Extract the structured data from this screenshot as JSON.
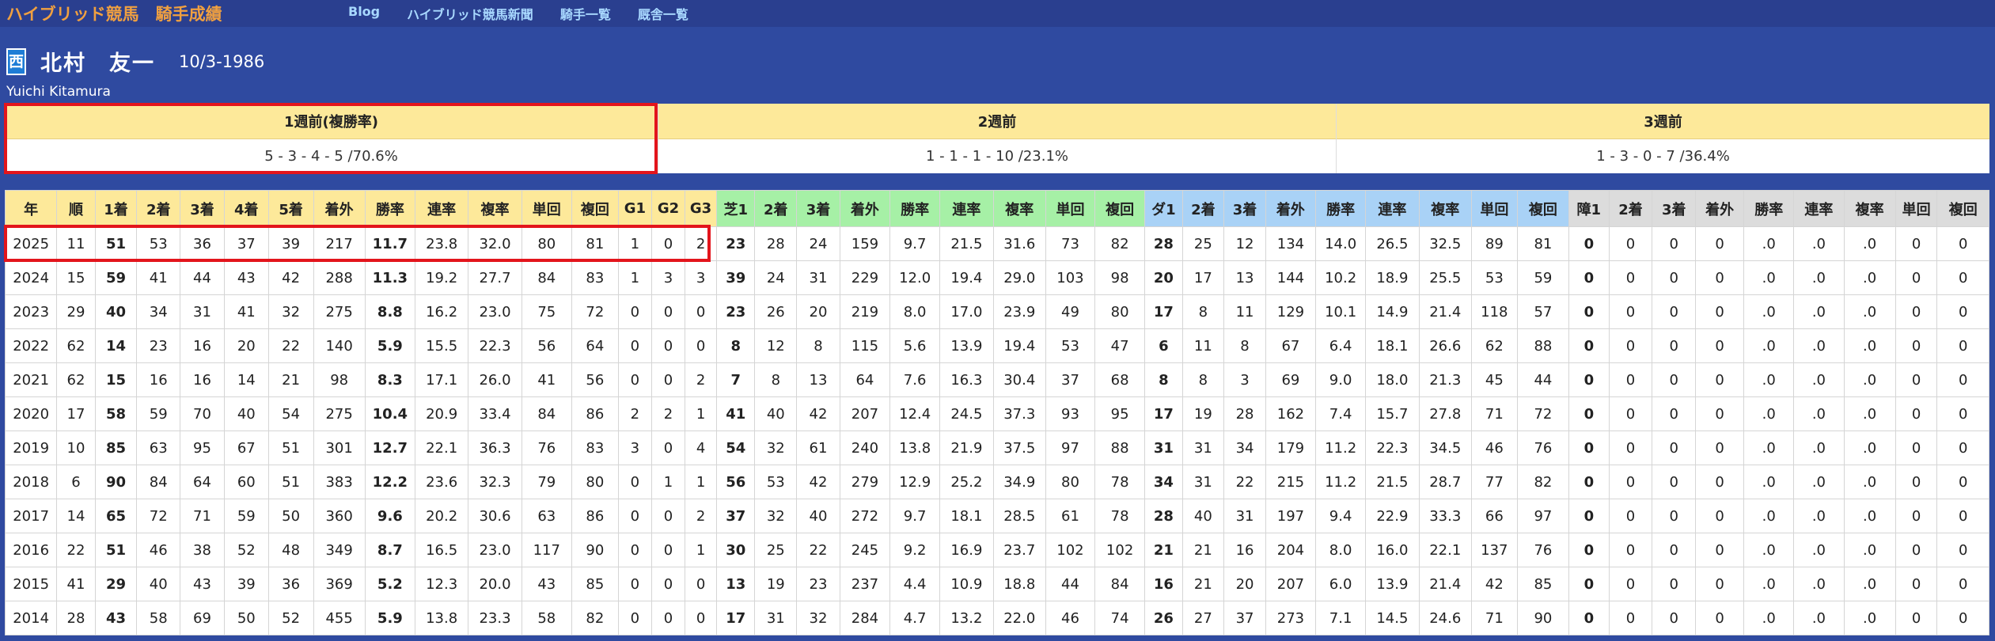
{
  "site": {
    "title": "ハイブリッド競馬　騎手成績",
    "nav": [
      "Blog",
      "ハイブリッド競馬新聞",
      "騎手一覧",
      "厩舎一覧"
    ]
  },
  "jockey": {
    "region": "西",
    "name": "北村　友一",
    "birth": "10/3-1986",
    "roman": "Yuichi Kitamura"
  },
  "weeks": [
    {
      "label": "1週前(複勝率)",
      "value": "5 - 3 - 4 - 5 /70.6%"
    },
    {
      "label": "2週前",
      "value": "1 - 1 - 1 - 10 /23.1%"
    },
    {
      "label": "3週前",
      "value": "1 - 3 - 0 - 7 /36.4%"
    }
  ],
  "colors": {
    "header_bg": "#2f4aa0",
    "overall": "#fde99a",
    "turf": "#a6f0a6",
    "dirt": "#a9d2f6",
    "jump": "#dcdcdc",
    "highlight": "#e3151c"
  },
  "table": {
    "headers": [
      "年",
      "順",
      "1着",
      "2着",
      "3着",
      "4着",
      "5着",
      "着外",
      "勝率",
      "連率",
      "複率",
      "単回",
      "複回",
      "G1",
      "G2",
      "G3",
      "芝1",
      "2着",
      "3着",
      "着外",
      "勝率",
      "連率",
      "複率",
      "単回",
      "複回",
      "ダ1",
      "2着",
      "3着",
      "着外",
      "勝率",
      "連率",
      "複率",
      "単回",
      "複回",
      "障1",
      "2着",
      "3着",
      "着外",
      "勝率",
      "連率",
      "複率",
      "単回",
      "複回"
    ],
    "rows": [
      [
        "2025",
        "11",
        "51",
        "53",
        "36",
        "37",
        "39",
        "217",
        "11.7",
        "23.8",
        "32.0",
        "80",
        "81",
        "1",
        "0",
        "2",
        "23",
        "28",
        "24",
        "159",
        "9.7",
        "21.5",
        "31.6",
        "73",
        "82",
        "28",
        "25",
        "12",
        "134",
        "14.0",
        "26.5",
        "32.5",
        "89",
        "81",
        "0",
        "0",
        "0",
        "0",
        ".0",
        ".0",
        ".0",
        "0",
        "0"
      ],
      [
        "2024",
        "15",
        "59",
        "41",
        "44",
        "43",
        "42",
        "288",
        "11.3",
        "19.2",
        "27.7",
        "84",
        "83",
        "1",
        "3",
        "3",
        "39",
        "24",
        "31",
        "229",
        "12.0",
        "19.4",
        "29.0",
        "103",
        "98",
        "20",
        "17",
        "13",
        "144",
        "10.2",
        "18.9",
        "25.5",
        "53",
        "59",
        "0",
        "0",
        "0",
        "0",
        ".0",
        ".0",
        ".0",
        "0",
        "0"
      ],
      [
        "2023",
        "29",
        "40",
        "34",
        "31",
        "41",
        "32",
        "275",
        "8.8",
        "16.2",
        "23.0",
        "75",
        "72",
        "0",
        "0",
        "0",
        "23",
        "26",
        "20",
        "219",
        "8.0",
        "17.0",
        "23.9",
        "49",
        "80",
        "17",
        "8",
        "11",
        "129",
        "10.1",
        "14.9",
        "21.4",
        "118",
        "57",
        "0",
        "0",
        "0",
        "0",
        ".0",
        ".0",
        ".0",
        "0",
        "0"
      ],
      [
        "2022",
        "62",
        "14",
        "23",
        "16",
        "20",
        "22",
        "140",
        "5.9",
        "15.5",
        "22.3",
        "56",
        "64",
        "0",
        "0",
        "0",
        "8",
        "12",
        "8",
        "115",
        "5.6",
        "13.9",
        "19.4",
        "53",
        "47",
        "6",
        "11",
        "8",
        "67",
        "6.4",
        "18.1",
        "26.6",
        "62",
        "88",
        "0",
        "0",
        "0",
        "0",
        ".0",
        ".0",
        ".0",
        "0",
        "0"
      ],
      [
        "2021",
        "62",
        "15",
        "16",
        "16",
        "14",
        "21",
        "98",
        "8.3",
        "17.1",
        "26.0",
        "41",
        "56",
        "0",
        "0",
        "2",
        "7",
        "8",
        "13",
        "64",
        "7.6",
        "16.3",
        "30.4",
        "37",
        "68",
        "8",
        "8",
        "3",
        "69",
        "9.0",
        "18.0",
        "21.3",
        "45",
        "44",
        "0",
        "0",
        "0",
        "0",
        ".0",
        ".0",
        ".0",
        "0",
        "0"
      ],
      [
        "2020",
        "17",
        "58",
        "59",
        "70",
        "40",
        "54",
        "275",
        "10.4",
        "20.9",
        "33.4",
        "84",
        "86",
        "2",
        "2",
        "1",
        "41",
        "40",
        "42",
        "207",
        "12.4",
        "24.5",
        "37.3",
        "93",
        "95",
        "17",
        "19",
        "28",
        "162",
        "7.4",
        "15.7",
        "27.8",
        "71",
        "72",
        "0",
        "0",
        "0",
        "0",
        ".0",
        ".0",
        ".0",
        "0",
        "0"
      ],
      [
        "2019",
        "10",
        "85",
        "63",
        "95",
        "67",
        "51",
        "301",
        "12.7",
        "22.1",
        "36.3",
        "76",
        "83",
        "3",
        "0",
        "4",
        "54",
        "32",
        "61",
        "240",
        "13.8",
        "21.9",
        "37.5",
        "97",
        "88",
        "31",
        "31",
        "34",
        "179",
        "11.2",
        "22.3",
        "34.5",
        "46",
        "76",
        "0",
        "0",
        "0",
        "0",
        ".0",
        ".0",
        ".0",
        "0",
        "0"
      ],
      [
        "2018",
        "6",
        "90",
        "84",
        "64",
        "60",
        "51",
        "383",
        "12.2",
        "23.6",
        "32.3",
        "79",
        "80",
        "0",
        "1",
        "1",
        "56",
        "53",
        "42",
        "279",
        "12.9",
        "25.2",
        "34.9",
        "80",
        "78",
        "34",
        "31",
        "22",
        "215",
        "11.2",
        "21.5",
        "28.7",
        "77",
        "82",
        "0",
        "0",
        "0",
        "0",
        ".0",
        ".0",
        ".0",
        "0",
        "0"
      ],
      [
        "2017",
        "14",
        "65",
        "72",
        "71",
        "59",
        "50",
        "360",
        "9.6",
        "20.2",
        "30.6",
        "63",
        "86",
        "0",
        "0",
        "2",
        "37",
        "32",
        "40",
        "272",
        "9.7",
        "18.1",
        "28.5",
        "61",
        "78",
        "28",
        "40",
        "31",
        "197",
        "9.4",
        "22.9",
        "33.3",
        "66",
        "97",
        "0",
        "0",
        "0",
        "0",
        ".0",
        ".0",
        ".0",
        "0",
        "0"
      ],
      [
        "2016",
        "22",
        "51",
        "46",
        "38",
        "52",
        "48",
        "349",
        "8.7",
        "16.5",
        "23.0",
        "117",
        "90",
        "0",
        "0",
        "1",
        "30",
        "25",
        "22",
        "245",
        "9.2",
        "16.9",
        "23.7",
        "102",
        "102",
        "21",
        "21",
        "16",
        "204",
        "8.0",
        "16.0",
        "22.1",
        "137",
        "76",
        "0",
        "0",
        "0",
        "0",
        ".0",
        ".0",
        ".0",
        "0",
        "0"
      ],
      [
        "2015",
        "41",
        "29",
        "40",
        "43",
        "39",
        "36",
        "369",
        "5.2",
        "12.3",
        "20.0",
        "43",
        "85",
        "0",
        "0",
        "0",
        "13",
        "19",
        "23",
        "237",
        "4.4",
        "10.9",
        "18.8",
        "44",
        "84",
        "16",
        "21",
        "20",
        "207",
        "6.0",
        "13.9",
        "21.4",
        "42",
        "85",
        "0",
        "0",
        "0",
        "0",
        ".0",
        ".0",
        ".0",
        "0",
        "0"
      ],
      [
        "2014",
        "28",
        "43",
        "58",
        "69",
        "50",
        "52",
        "455",
        "5.9",
        "13.8",
        "23.3",
        "58",
        "82",
        "0",
        "0",
        "0",
        "17",
        "31",
        "32",
        "284",
        "4.7",
        "13.2",
        "22.0",
        "46",
        "74",
        "26",
        "27",
        "37",
        "273",
        "7.1",
        "14.5",
        "24.6",
        "71",
        "90",
        "0",
        "0",
        "0",
        "0",
        ".0",
        ".0",
        ".0",
        "0",
        "0"
      ]
    ]
  }
}
